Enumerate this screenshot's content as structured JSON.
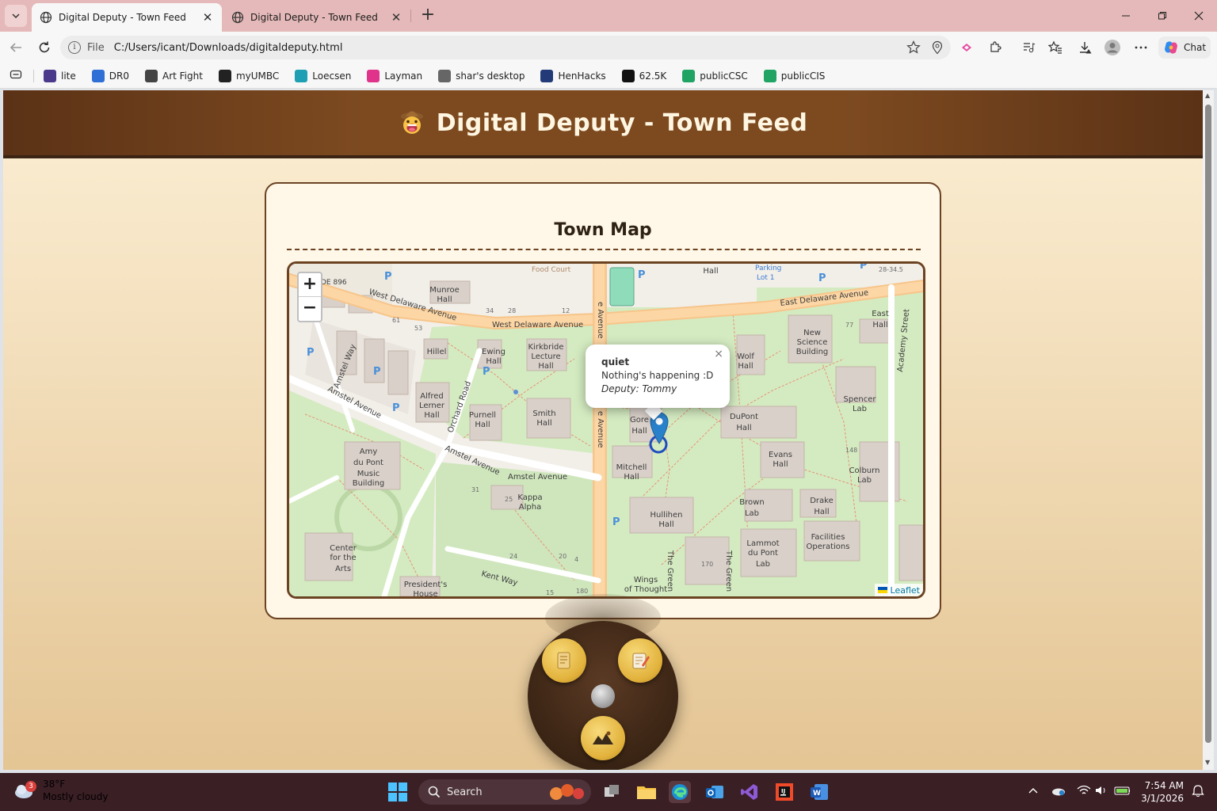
{
  "browser": {
    "tabs": [
      {
        "title": "Digital Deputy - Town Feed",
        "active": true
      },
      {
        "title": "Digital Deputy - Town Feed",
        "active": false
      }
    ],
    "address_label": "File",
    "address_url": "C:/Users/icant/Downloads/digitaldeputy.html",
    "chat_label": "Chat",
    "bookmarks": [
      {
        "label": "lite",
        "icon": "user-icon",
        "color": "#4b3a8c"
      },
      {
        "label": "DR0",
        "icon": "doc-icon",
        "color": "#2f6fd6"
      },
      {
        "label": "Art Fight",
        "icon": "swords-icon",
        "color": "#444444"
      },
      {
        "label": "myUMBC",
        "icon": "paw-icon",
        "color": "#222222"
      },
      {
        "label": "Loecsen",
        "icon": "gear-icon",
        "color": "#1f9fb3"
      },
      {
        "label": "Layman",
        "icon": "colorful-icon",
        "color": "#e0338a"
      },
      {
        "label": "shar's desktop",
        "icon": "gamepad-icon",
        "color": "#666666"
      },
      {
        "label": "HenHacks",
        "icon": "globe-icon",
        "color": "#223a78"
      },
      {
        "label": "62.5K",
        "icon": "tiktok-icon",
        "color": "#111111"
      },
      {
        "label": "publicCSC",
        "icon": "drive-icon",
        "color": "#1fa463"
      },
      {
        "label": "publicCIS",
        "icon": "drive-icon",
        "color": "#1fa463"
      }
    ]
  },
  "site": {
    "title": "Digital Deputy - Town Feed",
    "map_heading": "Town Map",
    "zoom_in": "+",
    "zoom_out": "−",
    "attribution": "Leaflet",
    "popup": {
      "title": "quiet",
      "message": "Nothing's happening :D",
      "deputy": "Deputy: Tommy",
      "close": "×"
    },
    "map_labels": {
      "roads": [
        "West Delaware Avenue",
        "West Delaware Avenue",
        "East Delaware Avenue",
        "Amstel Avenue",
        "Amstel Avenue",
        "Amstel Avenue",
        "Amstel Way",
        "Orchard Road",
        "Kent Way",
        "Academy Street",
        "The Green",
        "The Green",
        "e Avenue",
        "e Avenue",
        "DE 896"
      ],
      "buildings": [
        "Munroe Hall",
        "Hillel",
        "Ewing Hall",
        "Kirkbride Lecture Hall",
        "Alfred Lerner Hall",
        "Purnell Hall",
        "Smith Hall",
        "Amy du Pont Music Building",
        "Kappa Alpha",
        "Center for the Arts",
        "President's House",
        "Mitchell Hall",
        "Hullihen Hall",
        "Wolf Hall",
        "New Science Building",
        "East Hall",
        "Spencer Lab",
        "DuPont Hall",
        "Evans Hall",
        "Colburn Lab",
        "Brown Lab",
        "Drake Hall",
        "Lammot du Pont Lab",
        "Facilities Operations",
        "Wings of Thought",
        "Food Court",
        "Parking Lot 1",
        "Gore Hall",
        "Hall"
      ],
      "numbers": [
        "34",
        "28",
        "12",
        "61",
        "53",
        "31",
        "25",
        "24",
        "20",
        "4",
        "180",
        "15",
        "170",
        "77",
        "148",
        "28-34.5"
      ]
    }
  },
  "taskbar": {
    "weather_temp": "38°F",
    "weather_desc": "Mostly cloudy",
    "weather_badge": "3",
    "search_label": "Search",
    "time": "7:54 AM",
    "date": "3/1/2026"
  },
  "colors": {
    "header_brown": "#7d4a20",
    "card_border": "#6b4323",
    "map_marker": "#2a81cb",
    "tab_bar": "#e5b9b9",
    "taskbar": "#3a1f25"
  }
}
